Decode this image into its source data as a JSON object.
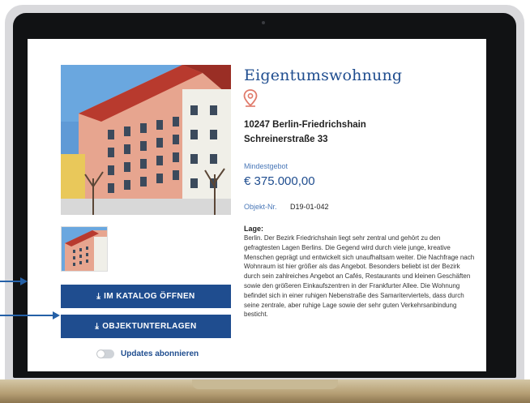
{
  "listing": {
    "title": "Eigentumswohnung",
    "address_line1": "10247 Berlin-Friedrichshain",
    "address_line2": "Schreinerstraße 33",
    "min_bid_label": "Mindestgebot",
    "price": "€ 375.000,00",
    "object_no_label": "Objekt-Nr.",
    "object_no": "D19-01-042",
    "location_heading": "Lage:",
    "location_text": "Berlin. Der Bezirk Friedrichshain liegt sehr zentral und gehört zu den gefragtesten Lagen Berlins. Die Gegend wird durch viele junge, kreative Menschen geprägt und entwickelt sich unaufhaltsam weiter. Die Nachfrage nach Wohnraum ist hier größer als das Angebot. Besonders beliebt ist der Bezirk durch sein zahlreiches Angebot an Cafés, Restaurants und kleinen Geschäften sowie den größeren Einkaufszentren in der Frankfurter Allee. Die Wohnung befindet sich in einer ruhigen Nebenstraße des Samariterviertels, dass durch seine zentrale, aber ruhige Lage sowie der sehr guten Verkehrsanbindung besticht."
  },
  "actions": {
    "catalog_label": "IM KATALOG ÖFFNEN",
    "documents_label": "OBJEKTUNTERLAGEN",
    "subscribe_label": "Updates abonnieren",
    "subscribe_on": false
  },
  "icons": {
    "download": "download-icon",
    "pin": "location-pin-icon"
  },
  "colors": {
    "brand_blue": "#1f4d8f",
    "pin_red": "#e07a6a"
  }
}
